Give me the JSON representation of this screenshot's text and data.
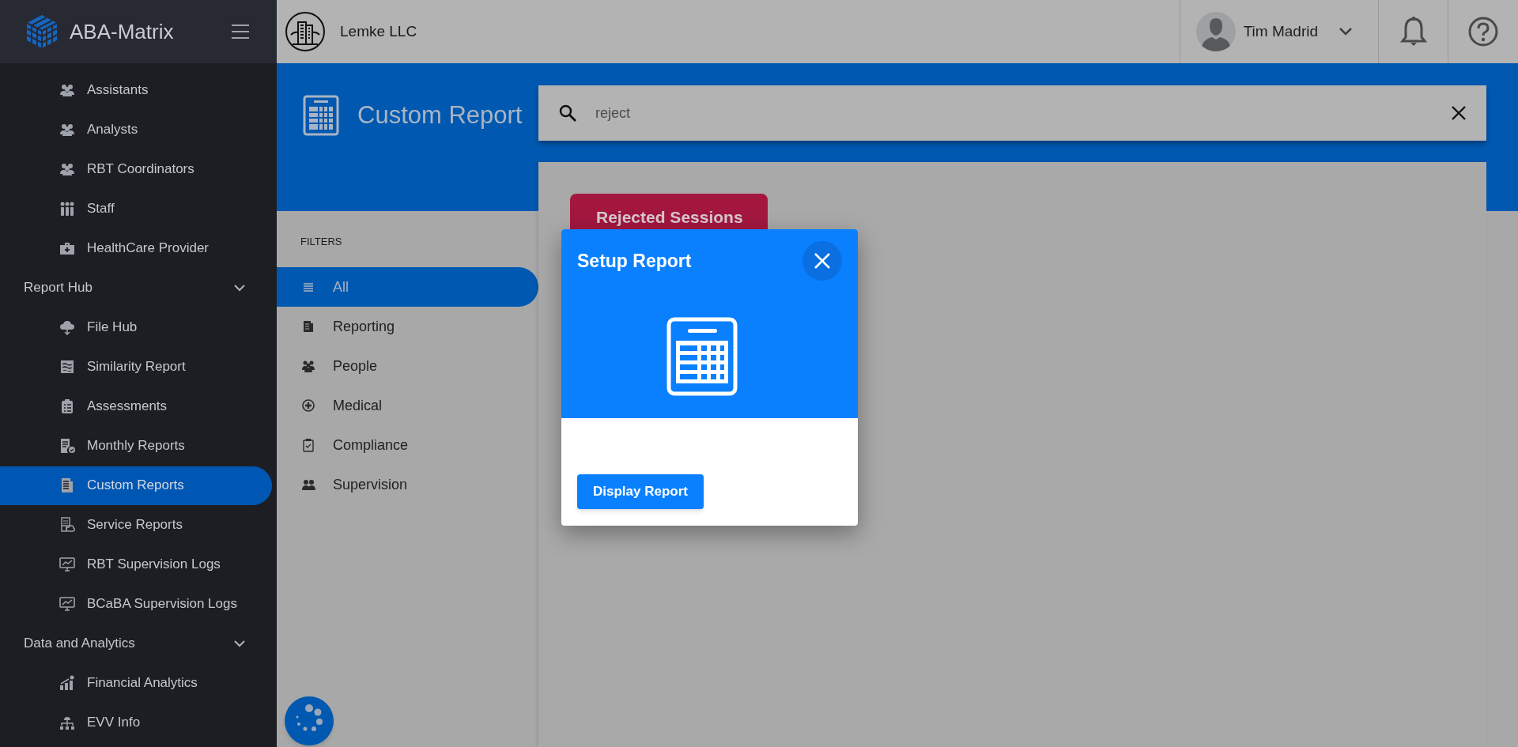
{
  "sidebar": {
    "brand": "ABA-Matrix",
    "items": [
      {
        "kind": "item",
        "label": "Assistants",
        "selected": false
      },
      {
        "kind": "item",
        "label": "Analysts",
        "selected": false
      },
      {
        "kind": "item",
        "label": "RBT Coordinators",
        "selected": false
      },
      {
        "kind": "item",
        "label": "Staff",
        "selected": false
      },
      {
        "kind": "item",
        "label": "HealthCare Provider",
        "selected": false
      },
      {
        "kind": "section",
        "label": "Report Hub",
        "expanded": true
      },
      {
        "kind": "item",
        "label": "File Hub",
        "selected": false
      },
      {
        "kind": "item",
        "label": "Similarity Report",
        "selected": false
      },
      {
        "kind": "item",
        "label": "Assessments",
        "selected": false
      },
      {
        "kind": "item",
        "label": "Monthly Reports",
        "selected": false
      },
      {
        "kind": "item",
        "label": "Custom Reports",
        "selected": true
      },
      {
        "kind": "item",
        "label": "Service Reports",
        "selected": false
      },
      {
        "kind": "item",
        "label": "RBT Supervision Logs",
        "selected": false
      },
      {
        "kind": "item",
        "label": "BCaBA Supervision Logs",
        "selected": false
      },
      {
        "kind": "section",
        "label": "Data and Analytics",
        "expanded": true
      },
      {
        "kind": "item",
        "label": "Financial Analytics",
        "selected": false
      },
      {
        "kind": "item",
        "label": "EVV Info",
        "selected": false
      }
    ]
  },
  "header": {
    "company": "Lemke LLC",
    "user": "Tim Madrid"
  },
  "page": {
    "title": "Custom Report",
    "search": {
      "value": "reject"
    }
  },
  "filters": {
    "heading": "FILTERS",
    "items": [
      {
        "label": "All",
        "selected": true
      },
      {
        "label": "Reporting",
        "selected": false
      },
      {
        "label": "People",
        "selected": false
      },
      {
        "label": "Medical",
        "selected": false
      },
      {
        "label": "Compliance",
        "selected": false
      },
      {
        "label": "Supervision",
        "selected": false
      }
    ]
  },
  "reports": [
    {
      "title": "Rejected Sessions"
    }
  ],
  "modal": {
    "title": "Setup Report",
    "button": "Display Report"
  }
}
